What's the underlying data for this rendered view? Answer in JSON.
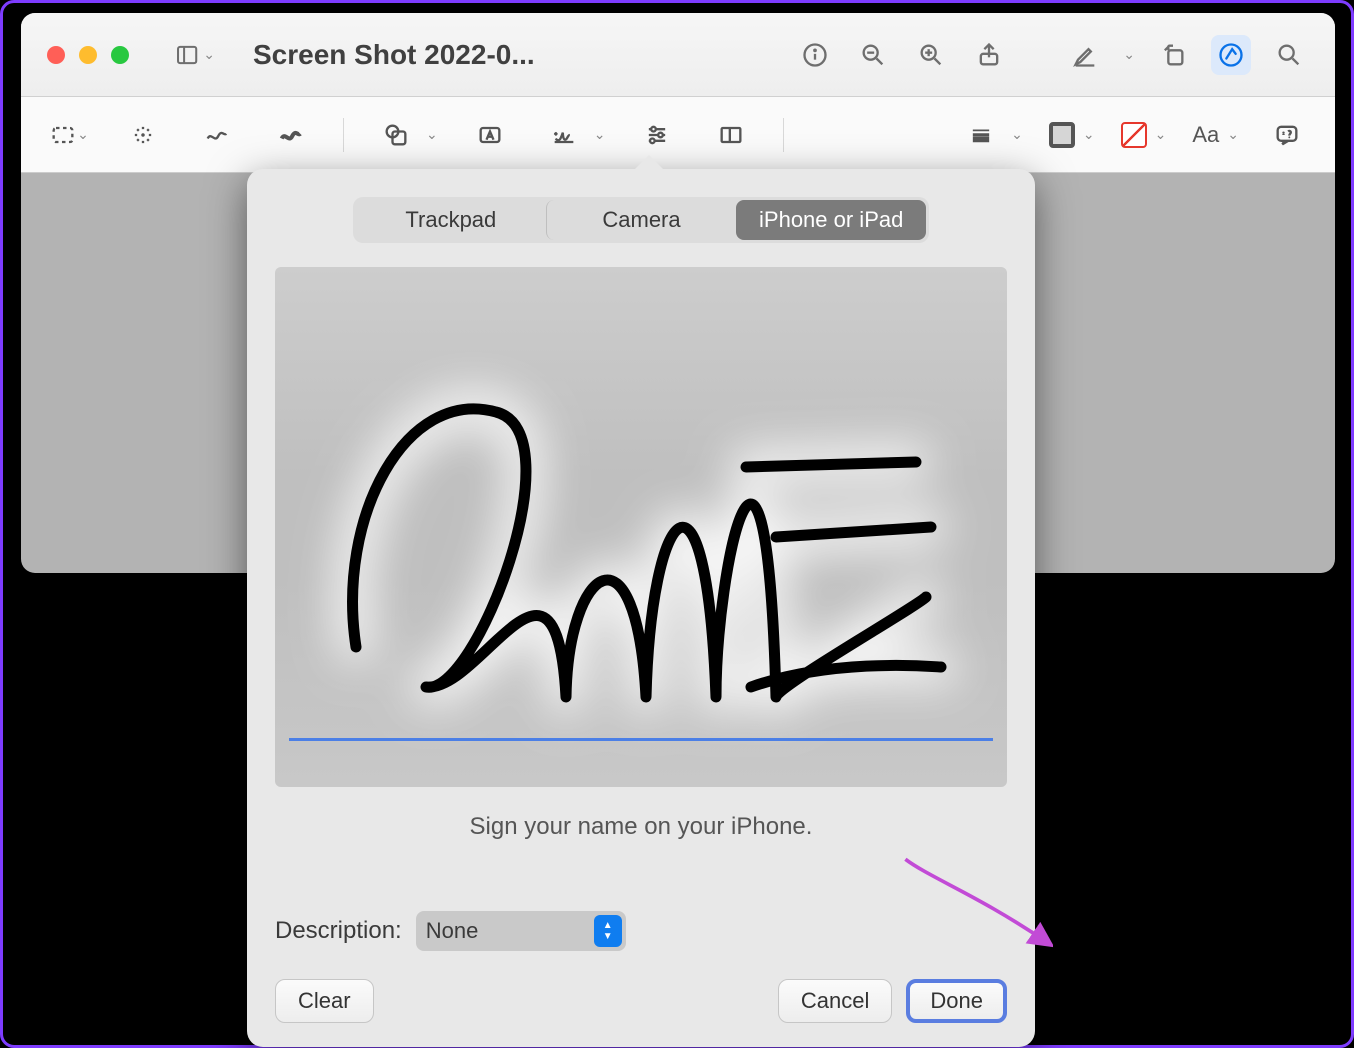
{
  "window": {
    "title": "Screen Shot 2022-0..."
  },
  "popover": {
    "tabs": {
      "trackpad": "Trackpad",
      "camera": "Camera",
      "iphone": "iPhone or iPad"
    },
    "instruction": "Sign your name on your iPhone.",
    "description_label": "Description:",
    "description_value": "None",
    "buttons": {
      "clear": "Clear",
      "cancel": "Cancel",
      "done": "Done"
    }
  },
  "markup": {
    "text_style_label": "Aa"
  },
  "colors": {
    "accent": "#0f7df0",
    "arrow": "#c24bd6"
  }
}
